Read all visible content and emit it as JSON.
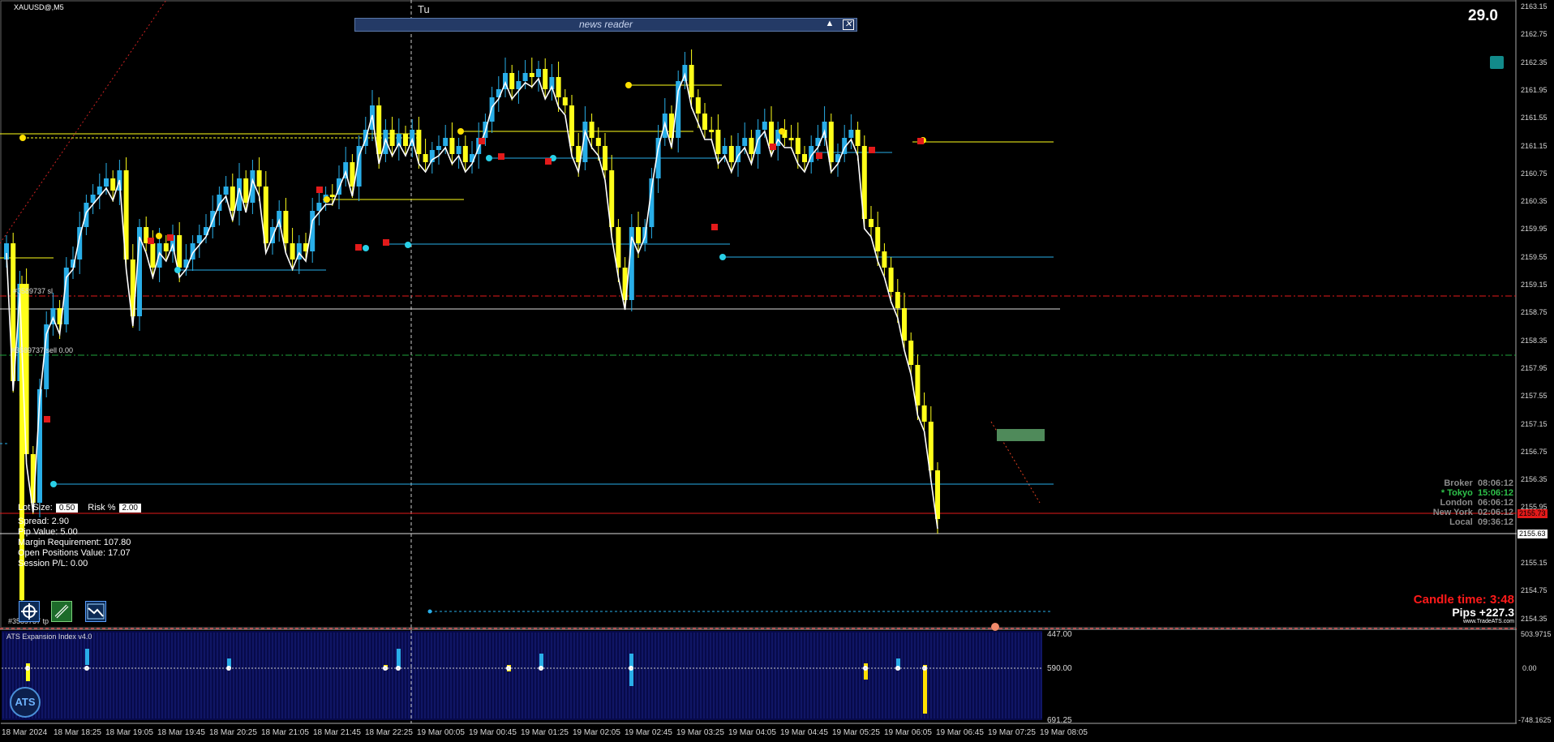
{
  "header": {
    "symbol": "XAUUSD@,M5",
    "day_marker": "Tu",
    "spread_readout": "29.0"
  },
  "news_reader": {
    "title": "news reader",
    "collapse_icon": "triangle-up-icon",
    "close_icon": "close-box-icon"
  },
  "order_labels": {
    "sl_label": "#3589737 sl",
    "sell_label": "#3589737 sell 0.00",
    "tp_label": "#3589737 tp"
  },
  "trade_panel": {
    "lot_label": "Lot Size:",
    "lot_value": "0.50",
    "risk_label": "Risk %",
    "risk_value": "2.00",
    "lines": [
      "Spread: 2.90",
      "Pip Value: 5.00",
      "Margin Requirement: 107.80",
      "Open Positions Value: 17.07",
      "Session P/L: 0.00"
    ]
  },
  "clocks": [
    {
      "label": "Broker",
      "time": "08:06:12",
      "color": "#8a8a8a"
    },
    {
      "label": "* Tokyo",
      "time": "15:06:12",
      "color": "#2ec24a"
    },
    {
      "label": "London",
      "time": "06:06:12",
      "color": "#8a8a8a"
    },
    {
      "label": "New York",
      "time": "02:06:12",
      "color": "#8a8a8a"
    },
    {
      "label": "Local",
      "time": "09:36:12",
      "color": "#8a8a8a"
    }
  ],
  "candle_time": "Candle time:  3:48",
  "pips": "Pips +227.3",
  "brand": "www.TradeATS.com",
  "price_axis": [
    "2163.15",
    "2162.75",
    "2162.35",
    "2161.95",
    "2161.55",
    "2161.15",
    "2160.75",
    "2160.35",
    "2159.95",
    "2159.55",
    "2159.15",
    "2158.75",
    "2158.35",
    "2157.95",
    "2157.55",
    "2157.15",
    "2156.75",
    "2156.35",
    "2155.95",
    "2155.55",
    "2155.15",
    "2154.75",
    "2154.35"
  ],
  "price_tags": {
    "bid": "2155.73",
    "level": "2155.63"
  },
  "time_axis": [
    "18 Mar 2024",
    "18 Mar 18:25",
    "18 Mar 19:05",
    "18 Mar 19:45",
    "18 Mar 20:25",
    "18 Mar 21:05",
    "18 Mar 21:45",
    "18 Mar 22:25",
    "19 Mar 00:05",
    "19 Mar 00:45",
    "19 Mar 01:25",
    "19 Mar 02:05",
    "19 Mar 02:45",
    "19 Mar 03:25",
    "19 Mar 04:05",
    "19 Mar 04:45",
    "19 Mar 05:25",
    "19 Mar 06:05",
    "19 Mar 06:45",
    "19 Mar 07:25",
    "19 Mar 08:05"
  ],
  "indicator": {
    "title": "ATS Expansion Index v4.0",
    "left_scale": [
      "447.00",
      "590.00",
      "691.25"
    ],
    "right_scale": [
      "503.9715",
      "0.00",
      "-748.1625"
    ],
    "logo_text": "ATS"
  },
  "colors": {
    "bull": "#29aee8",
    "bear": "#ffff1a",
    "background": "#000000",
    "ma_line": "#ffffff",
    "level_red": "#e31a1a",
    "level_green": "#1fa33a",
    "panel_bg": "#070a4a"
  },
  "toolbar_icons": [
    "crosshair-target-icon",
    "chain-link-icon",
    "chart-trend-icon"
  ]
}
